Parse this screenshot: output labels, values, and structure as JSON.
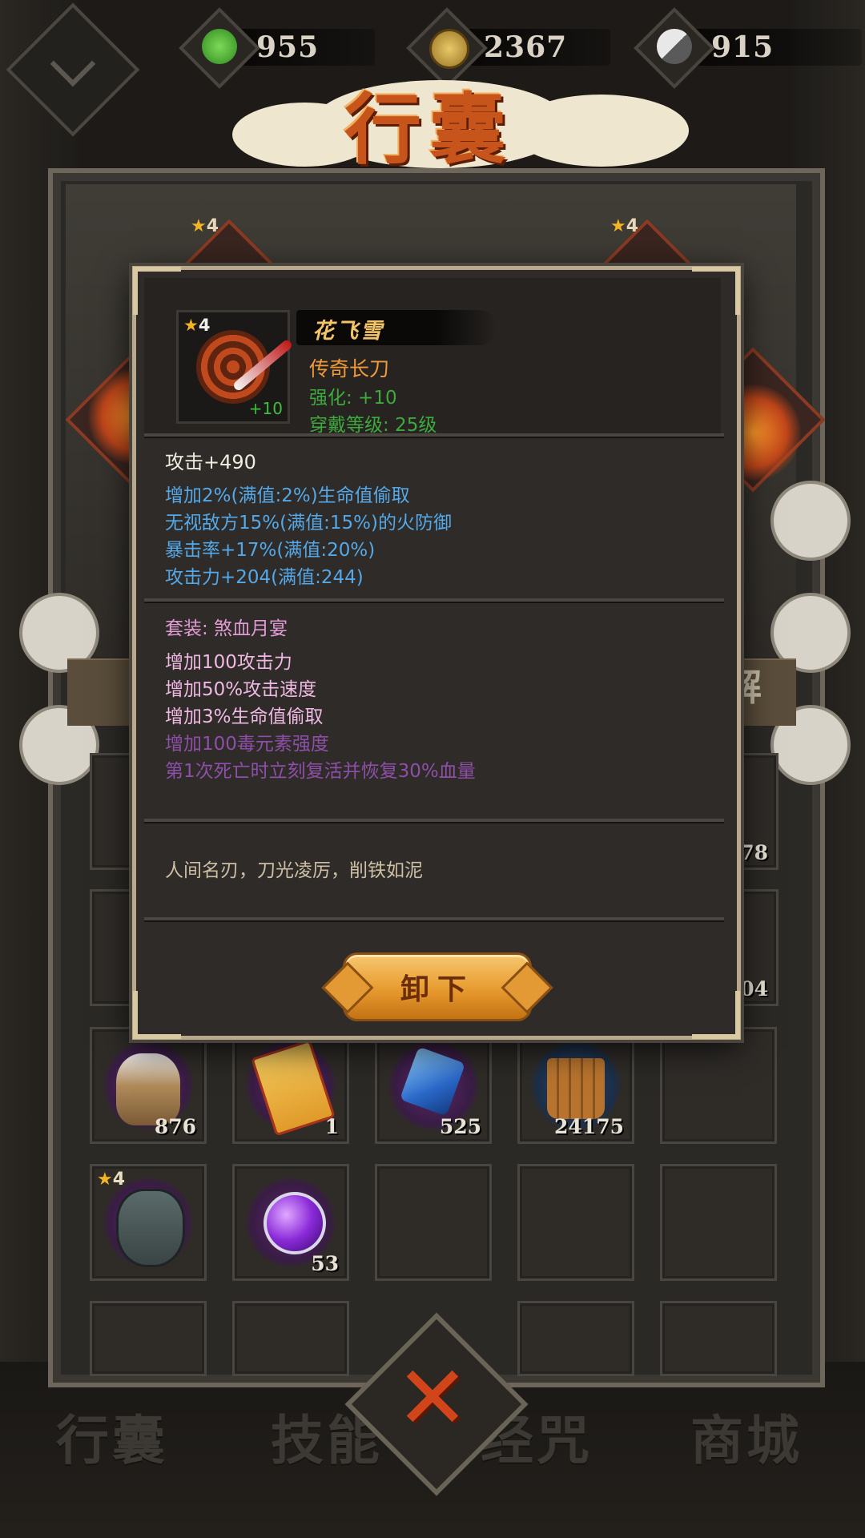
{
  "resources": [
    {
      "name": "jade",
      "icon": "green-flame-icon",
      "value": "955",
      "color": "#3a9a2a"
    },
    {
      "name": "coin",
      "icon": "copper-coin-icon",
      "value": "2367",
      "color": "#c9a44a"
    },
    {
      "name": "soul",
      "icon": "yin-yang-icon",
      "value": "915",
      "color": "#bdbdbd"
    }
  ],
  "header": {
    "title": "行囊"
  },
  "equipped": {
    "left_stars": "4",
    "right_stars": "4",
    "decompose_label": "解"
  },
  "inventory": {
    "row1": [
      {
        "count": "78"
      }
    ],
    "row2": [
      {
        "count": "04"
      }
    ],
    "row3": [
      {
        "icon": "flour-sack-icon",
        "count": "876"
      },
      {
        "icon": "scroll-icon",
        "count": "1"
      },
      {
        "icon": "blue-crystal-icon",
        "count": "525"
      },
      {
        "icon": "wood-bucket-icon",
        "count": "24175"
      },
      {
        "icon": "",
        "count": ""
      }
    ],
    "row4": [
      {
        "icon": "demon-mask-icon",
        "stars": "4",
        "count": ""
      },
      {
        "icon": "purple-orb-icon",
        "count": "53"
      }
    ]
  },
  "bottom_tabs": [
    "行囊",
    "技能",
    "经咒",
    "商城"
  ],
  "item": {
    "stars": "4",
    "enhance_badge": "+10",
    "name": "花飞雪",
    "type": "传奇长刀",
    "enhance": "强化: +10",
    "level": "穿戴等级: 25级",
    "base_stat": "攻击+490",
    "extra_stats": [
      "增加2%(满值:2%)生命值偷取",
      "无视敌方15%(满值:15%)的火防御",
      "暴击率+17%(满值:20%)",
      "攻击力+204(满值:244)"
    ],
    "set_title": "套装: 煞血月宴",
    "set_active": [
      "增加100攻击力",
      "增加50%攻击速度",
      "增加3%生命值偷取"
    ],
    "set_inactive": [
      "增加100毒元素强度",
      "第1次死亡时立刻复活并恢复30%血量"
    ],
    "description": "人间名刃，刀光凌厉，削铁如泥",
    "unequip_label": "卸下"
  }
}
